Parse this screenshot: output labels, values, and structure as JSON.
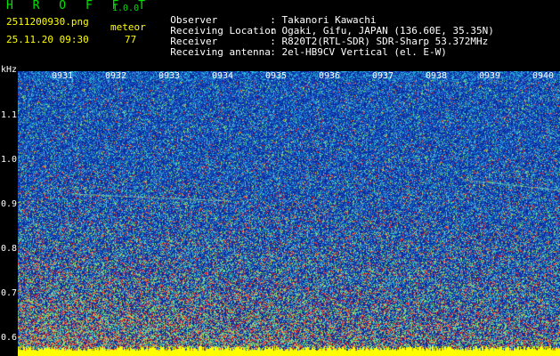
{
  "header": {
    "app_title": "H R O F F T",
    "version": "1.0.0",
    "filename": "2511200930.png",
    "datetime": "25.11.20 09:30",
    "detection_label": "meteor",
    "detection_count": "77"
  },
  "info": [
    {
      "label": "Observer",
      "value": ": Takanori Kawachi"
    },
    {
      "label": "Receiving Location",
      "value": ": Ogaki, Gifu, JAPAN (136.60E, 35.35N)"
    },
    {
      "label": "Receiver",
      "value": ": R820T2(RTL-SDR) SDR-Sharp 53.372MHz"
    },
    {
      "label": "Receiving antenna",
      "value": ": 2el-HB9CV Vertical (el. E-W)"
    }
  ],
  "spectrogram": {
    "y_unit": "kHz",
    "y_ticks": [
      "1.1",
      "1.0",
      "0.9",
      "0.8",
      "0.7",
      "0.6"
    ],
    "x_ticks": [
      "0931",
      "0932",
      "0933",
      "0934",
      "0935",
      "0936",
      "0937",
      "0938",
      "0939",
      "0940"
    ],
    "palette": {
      "background": "#0a2a9e",
      "noise_low": "#1a5cc8",
      "noise_mid": "#2ab8d8",
      "noise_high": "#8be06a",
      "hot": "#ff3b2b",
      "baseline": "#ffff00"
    }
  }
}
